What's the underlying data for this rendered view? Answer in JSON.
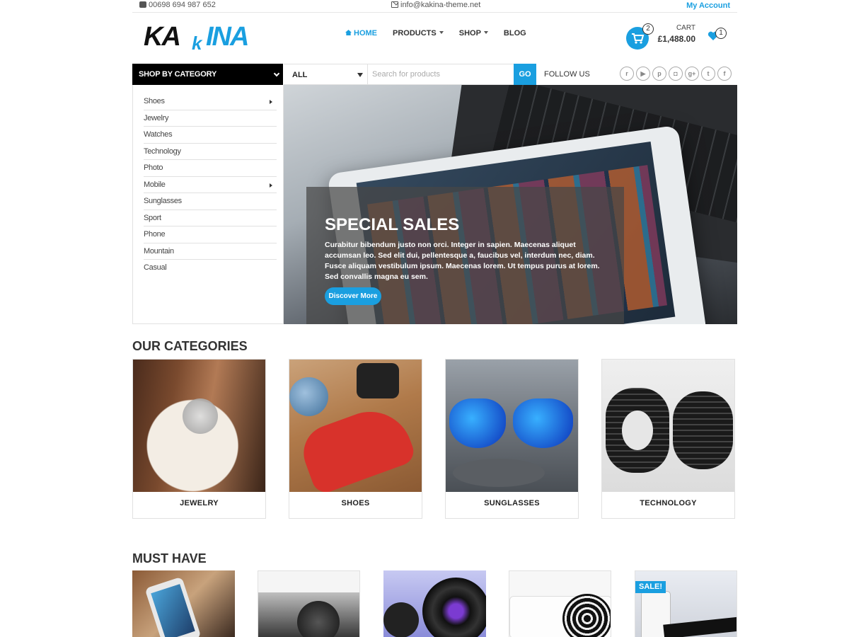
{
  "topbar": {
    "phone": "00698 694 987 652",
    "email": "info@kakina-theme.net",
    "account": "My Account"
  },
  "logo": {
    "text": "KAKINA"
  },
  "nav": {
    "items": [
      {
        "label": "HOME",
        "active": true,
        "dropdown": false
      },
      {
        "label": "PRODUCTS",
        "active": false,
        "dropdown": true
      },
      {
        "label": "SHOP",
        "active": false,
        "dropdown": true
      },
      {
        "label": "BLOG",
        "active": false,
        "dropdown": false
      }
    ]
  },
  "cart": {
    "count": "2",
    "label": "CART",
    "total": "£1,488.00"
  },
  "wishlist": {
    "count": "1"
  },
  "search_bar": {
    "category_header": "SHOP BY CATEGORY",
    "select_value": "ALL",
    "placeholder": "Search for products",
    "go_label": "GO",
    "follow_label": "FOLLOW US",
    "socials": [
      "reddit-icon",
      "youtube-icon",
      "pinterest-icon",
      "instagram-icon",
      "google-plus-icon",
      "twitter-icon",
      "facebook-icon"
    ]
  },
  "sidebar": {
    "items": [
      {
        "label": "Shoes",
        "submenu": true
      },
      {
        "label": "Jewelry",
        "submenu": false
      },
      {
        "label": "Watches",
        "submenu": false
      },
      {
        "label": "Technology",
        "submenu": false
      },
      {
        "label": "Photo",
        "submenu": false
      },
      {
        "label": "Mobile",
        "submenu": true
      },
      {
        "label": "Sunglasses",
        "submenu": false
      },
      {
        "label": "Sport",
        "submenu": false
      },
      {
        "label": "Phone",
        "submenu": false
      },
      {
        "label": "Mountain",
        "submenu": false
      },
      {
        "label": "Casual",
        "submenu": false
      }
    ]
  },
  "hero": {
    "title": "SPECIAL SALES",
    "text": "Curabitur bibendum justo non orci. Integer in sapien. Maecenas aliquet accumsan leo. Sed elit dui, pellentesque a, faucibus vel, interdum nec, diam. Fusce aliquam vestibulum ipsum. Maecenas lorem. Ut tempus purus at lorem. Sed convallis magna eu sem.",
    "button": "Discover More"
  },
  "categories": {
    "title": "OUR CATEGORIES",
    "items": [
      {
        "label": "JEWELRY"
      },
      {
        "label": "SHOES"
      },
      {
        "label": "SUNGLASSES"
      },
      {
        "label": "TECHNOLOGY"
      }
    ]
  },
  "must_have": {
    "title": "MUST HAVE",
    "sale_badge": "SALE!"
  },
  "colors": {
    "accent": "#1a9fe0",
    "dark": "#000000"
  }
}
